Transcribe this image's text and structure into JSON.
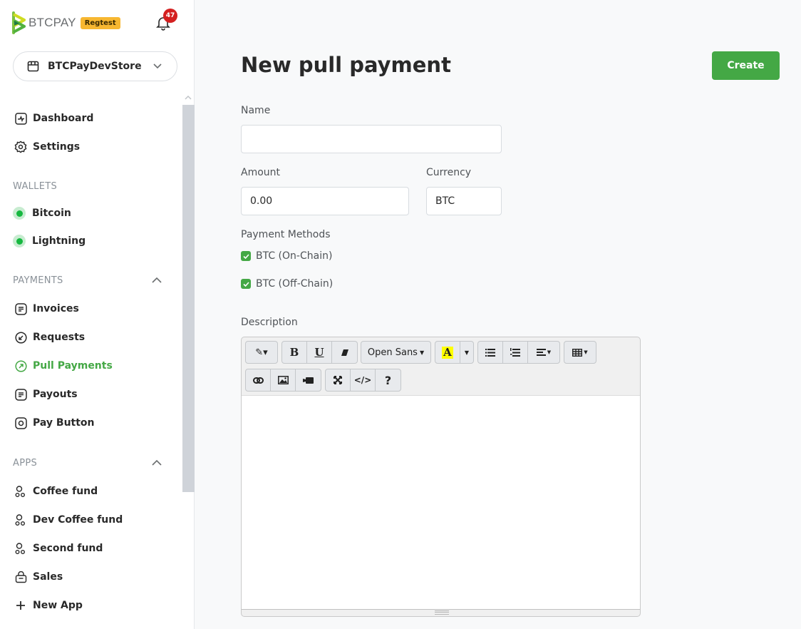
{
  "brand": {
    "name": "BTCPAY",
    "env_badge": "Regtest"
  },
  "notifications": {
    "count": "47"
  },
  "store": {
    "name": "BTCPayDevStore"
  },
  "nav": {
    "top": [
      {
        "label": "Dashboard",
        "icon": "dashboard-icon"
      },
      {
        "label": "Settings",
        "icon": "gear-icon"
      }
    ],
    "wallets_header": "WALLETS",
    "wallets": [
      {
        "label": "Bitcoin"
      },
      {
        "label": "Lightning"
      }
    ],
    "payments_header": "PAYMENTS",
    "payments": [
      {
        "label": "Invoices",
        "icon": "invoice-icon"
      },
      {
        "label": "Requests",
        "icon": "request-icon"
      },
      {
        "label": "Pull Payments",
        "icon": "pull-payment-icon",
        "active": true
      },
      {
        "label": "Payouts",
        "icon": "payout-icon"
      },
      {
        "label": "Pay Button",
        "icon": "pay-button-icon"
      }
    ],
    "apps_header": "APPS",
    "apps": [
      {
        "label": "Coffee fund",
        "icon": "crowdfund-icon"
      },
      {
        "label": "Dev Coffee fund",
        "icon": "crowdfund-icon"
      },
      {
        "label": "Second fund",
        "icon": "crowdfund-icon"
      },
      {
        "label": "Sales",
        "icon": "pos-icon"
      },
      {
        "label": "New App",
        "icon": "plus-icon"
      }
    ]
  },
  "page": {
    "title": "New pull payment",
    "create_label": "Create",
    "name_label": "Name",
    "name_value": "",
    "amount_label": "Amount",
    "amount_value": "0.00",
    "currency_label": "Currency",
    "currency_value": "BTC",
    "methods_label": "Payment Methods",
    "methods": [
      {
        "label": "BTC (On-Chain)",
        "checked": true
      },
      {
        "label": "BTC (Off-Chain)",
        "checked": true
      }
    ],
    "description_label": "Description",
    "editor": {
      "font_name": "Open Sans",
      "highlight_color": "#ffff00"
    }
  },
  "colors": {
    "accent": "#44a845",
    "badge": "#f7b731",
    "notification": "#d42020",
    "wallet_online": "#16b840"
  }
}
